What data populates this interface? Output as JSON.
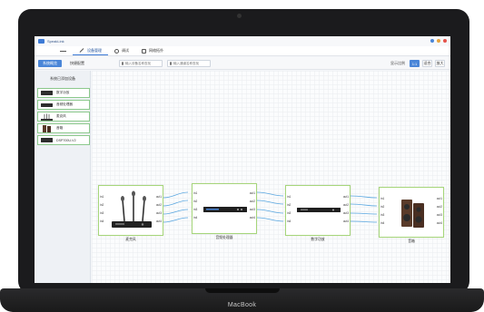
{
  "device": {
    "brand": "MacBook"
  },
  "app": {
    "title": "SpeakLink"
  },
  "tabs": [
    {
      "label": ""
    },
    {
      "label": "设备管理"
    },
    {
      "label": "调试"
    },
    {
      "label": "网络拓扑"
    }
  ],
  "toolbar": {
    "btn_primary": "系统概览",
    "btn_secondary": "快捷配置",
    "search1_placeholder": "输入设备名称查找",
    "search2_placeholder": "输入通道名称查找",
    "zoom_label": "显示比例",
    "zoom_options": [
      "1:1",
      "适合",
      "放大"
    ]
  },
  "sidebar": {
    "title": "系统已添加设备",
    "items": [
      {
        "label": "数字功放"
      },
      {
        "label": "音频处理器"
      },
      {
        "label": "麦克风"
      },
      {
        "label": "音箱"
      },
      {
        "label": "DSP700U-V2"
      }
    ]
  },
  "nodes": [
    {
      "caption": "麦克风",
      "ports_in": [
        "in1",
        "in2",
        "in3",
        "in4"
      ],
      "ports_out": [
        "out1",
        "out2",
        "out3",
        "out4"
      ]
    },
    {
      "caption": "音频处理器",
      "ports_in": [
        "in1",
        "in2",
        "in3",
        "in4"
      ],
      "ports_out": [
        "out1",
        "out2",
        "out3",
        "out4"
      ]
    },
    {
      "caption": "数字功放",
      "ports_in": [
        "in1",
        "in2",
        "in3",
        "in4"
      ],
      "ports_out": [
        "out1",
        "out2",
        "out3",
        "out4"
      ]
    },
    {
      "caption": "音箱",
      "ports_in": [
        "in1",
        "in2",
        "in3",
        "in4"
      ],
      "ports_out": [
        "out1",
        "out2",
        "out3",
        "out4"
      ]
    }
  ],
  "colors": {
    "accent": "#4a86d8",
    "node_border": "#a6d67a",
    "wire": "#5aa7e0",
    "window_close": "#e5534b",
    "window_max": "#e8a33d",
    "window_min": "#4a86d8"
  }
}
